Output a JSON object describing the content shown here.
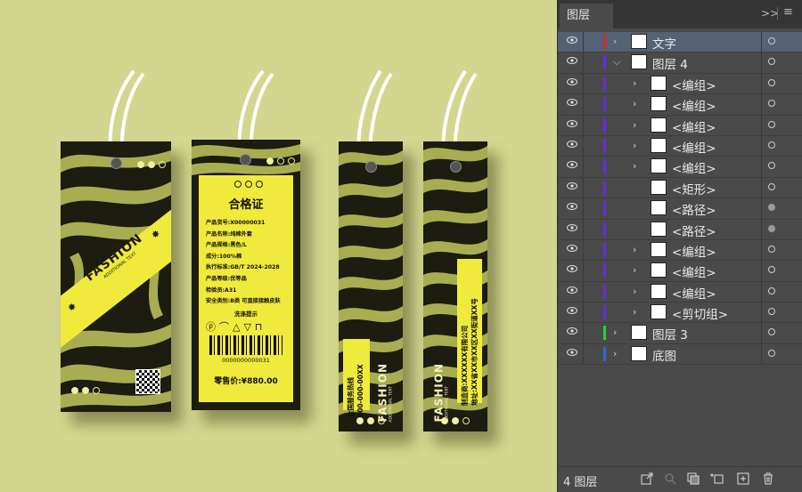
{
  "tag1": {
    "brand": "FASHION",
    "sub": "ADDITIONAL TEXT"
  },
  "tag2": {
    "title": "合格证",
    "lines": [
      "产品货号:X00000031",
      "产品名称:纯棉外套",
      "产品规格:黑色/L",
      "成分:100%棉",
      "执行标准:GB/T 2024-2028",
      "产品等级:优等品",
      "检验员:A31",
      "安全类别:B类 可直接接触皮肤"
    ],
    "wash_title": "洗涤提示",
    "barcode": "0000000000031",
    "price": "零售价:¥880.00"
  },
  "tag3": {
    "hotline_label": "全国服务热线",
    "hotline": "000-000-00XX",
    "brand": "FASHION",
    "sub": "ADDITIONAL TEXT"
  },
  "tag4": {
    "brand": "FASHION",
    "sub": "ADDITIONAL TEXT",
    "maker": "制造商:XXXXXX有限公司",
    "address": "地址:XX省XX市XX区XX街道XX号"
  },
  "panel": {
    "tab": "图层",
    "layers": [
      {
        "name": "文字",
        "color": "#e0242f",
        "level": 0,
        "twirl": ">",
        "selected": true,
        "target": "empty"
      },
      {
        "name": "图层 4",
        "color": "#6a2ae0",
        "level": 0,
        "twirl": "v",
        "selected": false,
        "target": "empty"
      },
      {
        "name": "<编组>",
        "color": "#6a2ae0",
        "level": 1,
        "twirl": ">",
        "selected": false,
        "target": "empty"
      },
      {
        "name": "<编组>",
        "color": "#6a2ae0",
        "level": 1,
        "twirl": ">",
        "selected": false,
        "target": "empty"
      },
      {
        "name": "<编组>",
        "color": "#6a2ae0",
        "level": 1,
        "twirl": ">",
        "selected": false,
        "target": "empty"
      },
      {
        "name": "<编组>",
        "color": "#6a2ae0",
        "level": 1,
        "twirl": ">",
        "selected": false,
        "target": "empty"
      },
      {
        "name": "<编组>",
        "color": "#6a2ae0",
        "level": 1,
        "twirl": ">",
        "selected": false,
        "target": "empty"
      },
      {
        "name": "<矩形>",
        "color": "#6a2ae0",
        "level": 1,
        "twirl": "",
        "selected": false,
        "target": "empty"
      },
      {
        "name": "<路径>",
        "color": "#6a2ae0",
        "level": 1,
        "twirl": "",
        "selected": false,
        "target": "filled"
      },
      {
        "name": "<路径>",
        "color": "#6a2ae0",
        "level": 1,
        "twirl": "",
        "selected": false,
        "target": "filled"
      },
      {
        "name": "<编组>",
        "color": "#6a2ae0",
        "level": 1,
        "twirl": ">",
        "selected": false,
        "target": "empty"
      },
      {
        "name": "<编组>",
        "color": "#6a2ae0",
        "level": 1,
        "twirl": ">",
        "selected": false,
        "target": "empty"
      },
      {
        "name": "<编组>",
        "color": "#6a2ae0",
        "level": 1,
        "twirl": ">",
        "selected": false,
        "target": "empty"
      },
      {
        "name": "<剪切组>",
        "color": "#6a2ae0",
        "level": 1,
        "twirl": ">",
        "selected": false,
        "target": "empty"
      },
      {
        "name": "图层 3",
        "color": "#27d13b",
        "level": 0,
        "twirl": ">",
        "selected": false,
        "target": "empty"
      },
      {
        "name": "底图",
        "color": "#2a6ae0",
        "level": 0,
        "twirl": ">",
        "selected": false,
        "target": "empty"
      }
    ],
    "footer_count": "4 图层"
  }
}
